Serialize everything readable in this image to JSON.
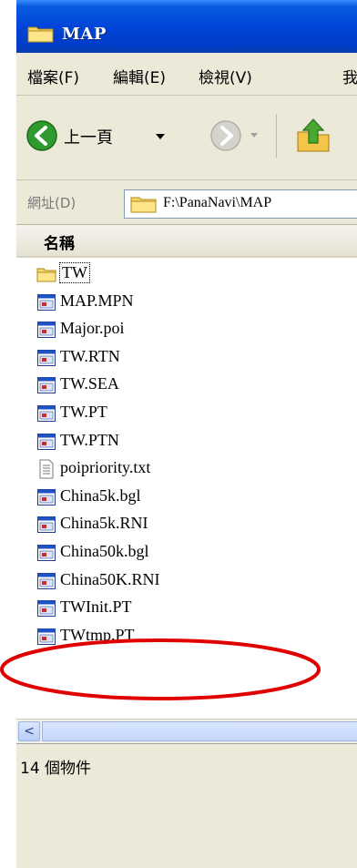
{
  "window": {
    "title": "MAP"
  },
  "menu": {
    "items": [
      "檔案(F)",
      "編輯(E)",
      "檢視(V)",
      "我"
    ]
  },
  "toolbar": {
    "back_label": "上一頁"
  },
  "address": {
    "label": "網址(D)",
    "path": "F:\\PanaNavi\\MAP"
  },
  "list": {
    "column_header": "名稱",
    "files": [
      {
        "name": "TW",
        "icon": "folder-icon"
      },
      {
        "name": "MAP.MPN",
        "icon": "application-file-icon"
      },
      {
        "name": "Major.poi",
        "icon": "application-file-icon"
      },
      {
        "name": "TW.RTN",
        "icon": "application-file-icon"
      },
      {
        "name": "TW.SEA",
        "icon": "application-file-icon"
      },
      {
        "name": "TW.PT",
        "icon": "application-file-icon"
      },
      {
        "name": "TW.PTN",
        "icon": "application-file-icon"
      },
      {
        "name": "poipriority.txt",
        "icon": "text-file-icon"
      },
      {
        "name": "China5k.bgl",
        "icon": "application-file-icon"
      },
      {
        "name": "China5k.RNI",
        "icon": "application-file-icon"
      },
      {
        "name": "China50k.bgl",
        "icon": "application-file-icon"
      },
      {
        "name": "China50K.RNI",
        "icon": "application-file-icon"
      },
      {
        "name": "TWInit.PT",
        "icon": "application-file-icon"
      },
      {
        "name": "TWtmp.PT",
        "icon": "application-file-icon"
      }
    ]
  },
  "status": {
    "text": "14 個物件"
  },
  "colors": {
    "title_bar": "#0045d8",
    "chrome": "#ECE9D8",
    "annotation": "#e00000",
    "back_button": "#2f9a2f"
  }
}
